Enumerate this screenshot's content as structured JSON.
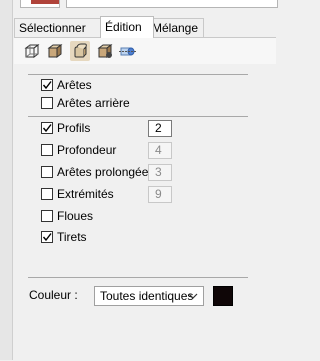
{
  "tabs": [
    {
      "label": "Sélectionner",
      "active": false
    },
    {
      "label": "Édition",
      "active": true
    },
    {
      "label": "Mélange",
      "active": false
    }
  ],
  "toolbar_icons": [
    {
      "name": "box-wireframe-icon",
      "selected": false
    },
    {
      "name": "box-shaded-icon",
      "selected": false
    },
    {
      "name": "box-rounded-icon",
      "selected": true
    },
    {
      "name": "box-texture-icon",
      "selected": false
    },
    {
      "name": "cylinder-xray-icon",
      "selected": false
    }
  ],
  "options": {
    "aretes": {
      "label": "Arêtes",
      "checked": true
    },
    "aretes_arriere": {
      "label": "Arêtes arrière",
      "checked": false
    },
    "profils": {
      "label": "Profils",
      "checked": true,
      "value": "2"
    },
    "profondeur": {
      "label": "Profondeur",
      "checked": false,
      "value": "4"
    },
    "aretes_prolongees": {
      "label": "Arêtes prolongées",
      "checked": false,
      "value": "3"
    },
    "extremites": {
      "label": "Extrémités",
      "checked": false,
      "value": "9"
    },
    "floues": {
      "label": "Floues",
      "checked": false
    },
    "tirets": {
      "label": "Tirets",
      "checked": true
    }
  },
  "color": {
    "label": "Couleur :",
    "select_value": "Toutes identiques",
    "swatch_color": "#0f0607"
  },
  "colors": {
    "accent_selected": "#e6d8bf",
    "top_swatch": "#b0433a"
  }
}
